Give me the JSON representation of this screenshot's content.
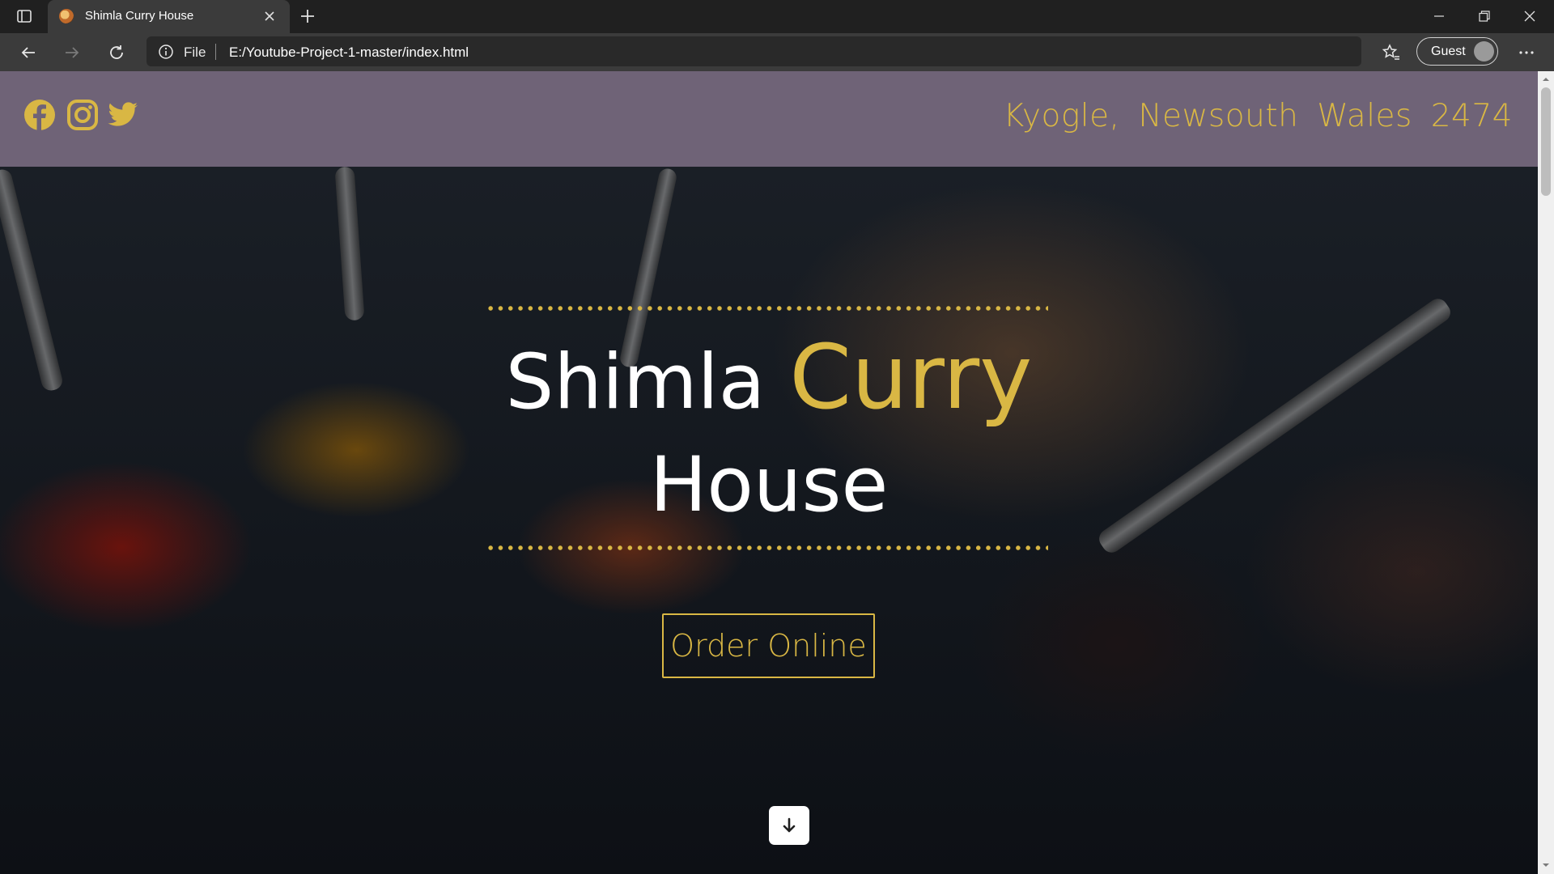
{
  "browser": {
    "tab_title": "Shimla Curry House",
    "address_prefix": "File",
    "url": "E:/Youtube-Project-1-master/index.html",
    "profile_label": "Guest"
  },
  "site": {
    "header": {
      "social_icons": [
        "facebook-icon",
        "instagram-icon",
        "twitter-icon"
      ],
      "address": "Kyogle,  Newsouth  Wales  2474"
    },
    "hero": {
      "title_word_1": "Shimla",
      "title_word_2": "Curry",
      "title_line_2": "House",
      "order_button": "Order Online",
      "scroll_icon": "arrow-down-icon"
    },
    "colors": {
      "accent": "#d9b744",
      "header_bg": "#6f6377",
      "text": "#ffffff"
    }
  }
}
